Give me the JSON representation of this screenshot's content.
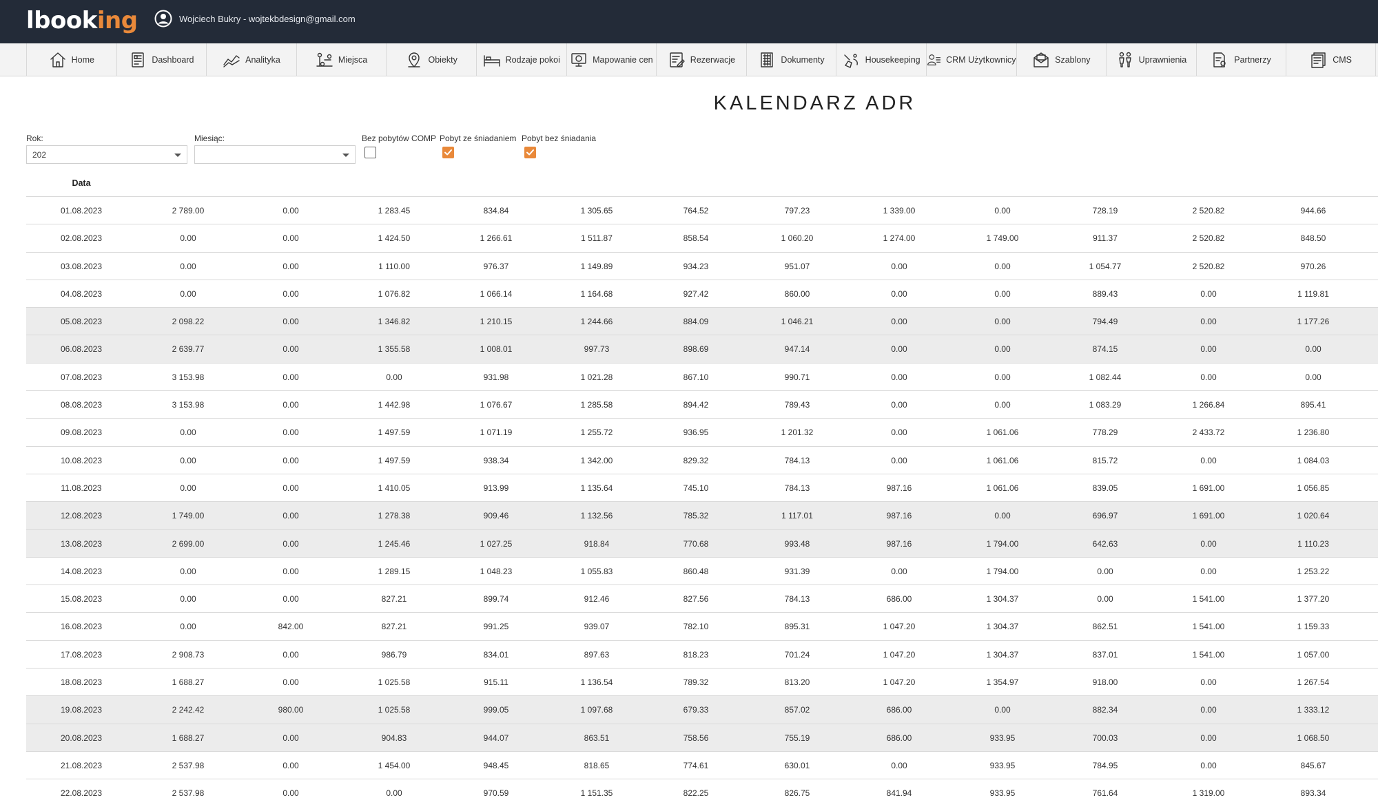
{
  "header": {
    "logo": {
      "prefix": "l",
      "main": "book",
      "accent": "ing"
    },
    "user_label": "Wojciech Bukry - wojtekbdesign@gmail.com"
  },
  "nav": [
    {
      "label": "Home",
      "icon": "home-icon"
    },
    {
      "label": "Dashboard",
      "icon": "dashboard-icon"
    },
    {
      "label": "Analityka",
      "icon": "analytics-icon"
    },
    {
      "label": "Miejsca",
      "icon": "places-icon"
    },
    {
      "label": "Obiekty",
      "icon": "location-pin-icon"
    },
    {
      "label": "Rodzaje pokoi",
      "icon": "bed-icon"
    },
    {
      "label": "Mapowanie cen",
      "icon": "price-mapping-icon"
    },
    {
      "label": "Rezerwacje",
      "icon": "reservations-icon"
    },
    {
      "label": "Dokumenty",
      "icon": "documents-icon"
    },
    {
      "label": "Housekeeping",
      "icon": "housekeeping-icon"
    },
    {
      "label": "CRM Użytkownicy",
      "icon": "crm-users-icon"
    },
    {
      "label": "Szablony",
      "icon": "templates-icon"
    },
    {
      "label": "Uprawnienia",
      "icon": "permissions-icon"
    },
    {
      "label": "Partnerzy",
      "icon": "partners-icon"
    },
    {
      "label": "CMS",
      "icon": "cms-icon"
    }
  ],
  "page_title": "KALENDARZ ADR",
  "filters": {
    "year_label": "Rok:",
    "year_value": "202",
    "month_label": "Miesiąc:",
    "month_value": "",
    "checkboxes": [
      {
        "label": "Bez pobytów COMP",
        "checked": false
      },
      {
        "label": "Pobyt ze śniadaniem",
        "checked": true
      },
      {
        "label": "Pobyt bez śniadania",
        "checked": true
      }
    ]
  },
  "table": {
    "date_header": "Data",
    "rows": [
      {
        "date": "01.08.2023",
        "shade": false,
        "values": [
          "2 789.00",
          "0.00",
          "1 283.45",
          "834.84",
          "1 305.65",
          "764.52",
          "797.23",
          "1 339.00",
          "0.00",
          "728.19",
          "2 520.82",
          "944.66"
        ]
      },
      {
        "date": "02.08.2023",
        "shade": false,
        "values": [
          "0.00",
          "0.00",
          "1 424.50",
          "1 266.61",
          "1 511.87",
          "858.54",
          "1 060.20",
          "1 274.00",
          "1 749.00",
          "911.37",
          "2 520.82",
          "848.50"
        ]
      },
      {
        "date": "03.08.2023",
        "shade": false,
        "values": [
          "0.00",
          "0.00",
          "1 110.00",
          "976.37",
          "1 149.89",
          "934.23",
          "951.07",
          "0.00",
          "0.00",
          "1 054.77",
          "2 520.82",
          "970.26"
        ]
      },
      {
        "date": "04.08.2023",
        "shade": false,
        "values": [
          "0.00",
          "0.00",
          "1 076.82",
          "1 066.14",
          "1 164.68",
          "927.42",
          "860.00",
          "0.00",
          "0.00",
          "889.43",
          "0.00",
          "1 119.81"
        ]
      },
      {
        "date": "05.08.2023",
        "shade": true,
        "values": [
          "2 098.22",
          "0.00",
          "1 346.82",
          "1 210.15",
          "1 244.66",
          "884.09",
          "1 046.21",
          "0.00",
          "0.00",
          "794.49",
          "0.00",
          "1 177.26"
        ]
      },
      {
        "date": "06.08.2023",
        "shade": true,
        "values": [
          "2 639.77",
          "0.00",
          "1 355.58",
          "1 008.01",
          "997.73",
          "898.69",
          "947.14",
          "0.00",
          "0.00",
          "874.15",
          "0.00",
          "0.00"
        ]
      },
      {
        "date": "07.08.2023",
        "shade": false,
        "values": [
          "3 153.98",
          "0.00",
          "0.00",
          "931.98",
          "1 021.28",
          "867.10",
          "990.71",
          "0.00",
          "0.00",
          "1 082.44",
          "0.00",
          "0.00"
        ]
      },
      {
        "date": "08.08.2023",
        "shade": false,
        "values": [
          "3 153.98",
          "0.00",
          "1 442.98",
          "1 076.67",
          "1 285.58",
          "894.42",
          "789.43",
          "0.00",
          "0.00",
          "1 083.29",
          "1 266.84",
          "895.41"
        ]
      },
      {
        "date": "09.08.2023",
        "shade": false,
        "values": [
          "0.00",
          "0.00",
          "1 497.59",
          "1 071.19",
          "1 255.72",
          "936.95",
          "1 201.32",
          "0.00",
          "1 061.06",
          "778.29",
          "2 433.72",
          "1 236.80"
        ]
      },
      {
        "date": "10.08.2023",
        "shade": false,
        "values": [
          "0.00",
          "0.00",
          "1 497.59",
          "938.34",
          "1 342.00",
          "829.32",
          "784.13",
          "0.00",
          "1 061.06",
          "815.72",
          "0.00",
          "1 084.03"
        ]
      },
      {
        "date": "11.08.2023",
        "shade": false,
        "values": [
          "0.00",
          "0.00",
          "1 410.05",
          "913.99",
          "1 135.64",
          "745.10",
          "784.13",
          "987.16",
          "1 061.06",
          "839.05",
          "1 691.00",
          "1 056.85"
        ]
      },
      {
        "date": "12.08.2023",
        "shade": true,
        "values": [
          "1 749.00",
          "0.00",
          "1 278.38",
          "909.46",
          "1 132.56",
          "785.32",
          "1 117.01",
          "987.16",
          "0.00",
          "696.97",
          "1 691.00",
          "1 020.64"
        ]
      },
      {
        "date": "13.08.2023",
        "shade": true,
        "values": [
          "2 699.00",
          "0.00",
          "1 245.46",
          "1 027.25",
          "918.84",
          "770.68",
          "993.48",
          "987.16",
          "1 794.00",
          "642.63",
          "0.00",
          "1 110.23"
        ]
      },
      {
        "date": "14.08.2023",
        "shade": false,
        "values": [
          "0.00",
          "0.00",
          "1 289.15",
          "1 048.23",
          "1 055.83",
          "860.48",
          "931.39",
          "0.00",
          "1 794.00",
          "0.00",
          "0.00",
          "1 253.22"
        ]
      },
      {
        "date": "15.08.2023",
        "shade": false,
        "values": [
          "0.00",
          "0.00",
          "827.21",
          "899.74",
          "912.46",
          "827.56",
          "784.13",
          "686.00",
          "1 304.37",
          "0.00",
          "1 541.00",
          "1 377.20"
        ]
      },
      {
        "date": "16.08.2023",
        "shade": false,
        "values": [
          "0.00",
          "842.00",
          "827.21",
          "991.25",
          "939.07",
          "782.10",
          "895.31",
          "1 047.20",
          "1 304.37",
          "862.51",
          "1 541.00",
          "1 159.33"
        ]
      },
      {
        "date": "17.08.2023",
        "shade": false,
        "values": [
          "2 908.73",
          "0.00",
          "986.79",
          "834.01",
          "897.63",
          "818.23",
          "701.24",
          "1 047.20",
          "1 304.37",
          "837.01",
          "1 541.00",
          "1 057.00"
        ]
      },
      {
        "date": "18.08.2023",
        "shade": false,
        "values": [
          "1 688.27",
          "0.00",
          "1 025.58",
          "915.11",
          "1 136.54",
          "789.32",
          "813.20",
          "1 047.20",
          "1 354.97",
          "918.00",
          "0.00",
          "1 267.54"
        ]
      },
      {
        "date": "19.08.2023",
        "shade": true,
        "values": [
          "2 242.42",
          "980.00",
          "1 025.58",
          "999.05",
          "1 097.68",
          "679.33",
          "857.02",
          "686.00",
          "0.00",
          "882.34",
          "0.00",
          "1 333.12"
        ]
      },
      {
        "date": "20.08.2023",
        "shade": true,
        "values": [
          "1 688.27",
          "0.00",
          "904.83",
          "944.07",
          "863.51",
          "758.56",
          "755.19",
          "686.00",
          "933.95",
          "700.03",
          "0.00",
          "1 068.50"
        ]
      },
      {
        "date": "21.08.2023",
        "shade": false,
        "values": [
          "2 537.98",
          "0.00",
          "1 454.00",
          "948.45",
          "818.65",
          "774.61",
          "630.01",
          "0.00",
          "933.95",
          "784.95",
          "0.00",
          "845.67"
        ]
      },
      {
        "date": "22.08.2023",
        "shade": false,
        "values": [
          "2 537.98",
          "0.00",
          "0.00",
          "970.59",
          "1 151.35",
          "822.25",
          "826.75",
          "841.94",
          "933.95",
          "761.64",
          "1 319.00",
          "893.34"
        ]
      }
    ]
  }
}
